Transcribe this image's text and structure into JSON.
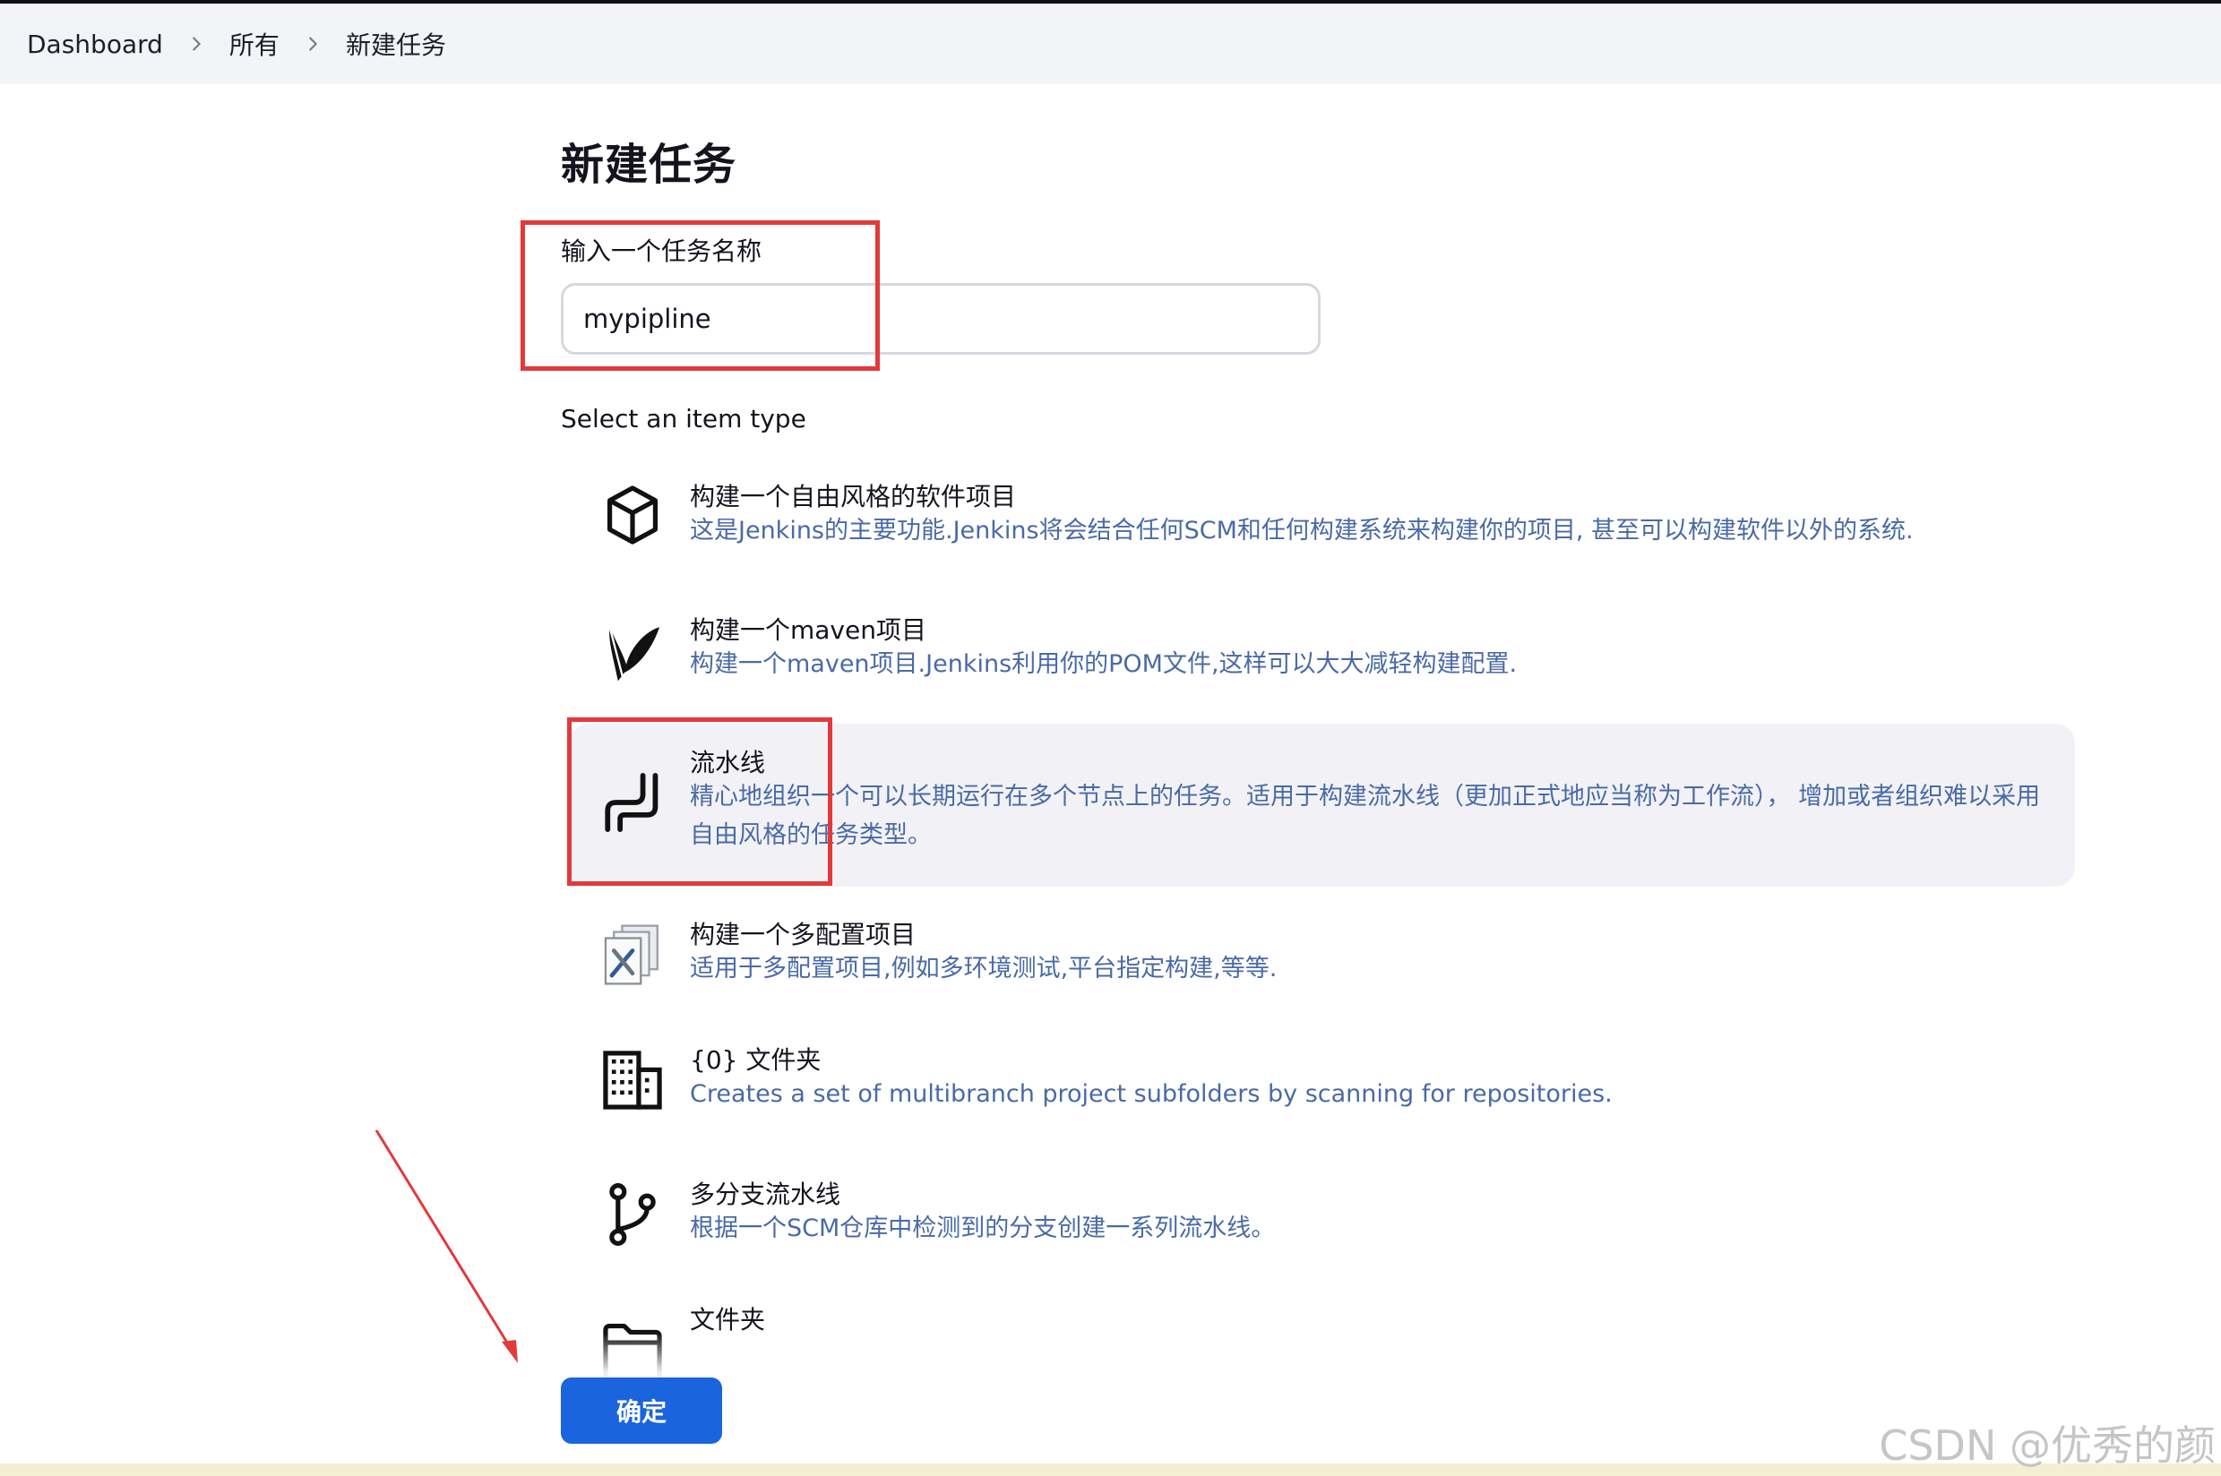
{
  "breadcrumb": [
    {
      "label": "Dashboard"
    },
    {
      "label": "所有"
    },
    {
      "label": "新建任务"
    }
  ],
  "page_title": "新建任务",
  "name_field": {
    "label": "输入一个任务名称",
    "value": "mypipline"
  },
  "item_type_label": "Select an item type",
  "items": [
    {
      "title": "构建一个自由风格的软件项目",
      "desc": "这是Jenkins的主要功能.Jenkins将会结合任何SCM和任何构建系统来构建你的项目, 甚至可以构建软件以外的系统.",
      "icon": "box-icon"
    },
    {
      "title": "构建一个maven项目",
      "desc": "构建一个maven项目.Jenkins利用你的POM文件,这样可以大大减轻构建配置.",
      "icon": "feather-icon"
    },
    {
      "title": "流水线",
      "desc": "精心地组织一个可以长期运行在多个节点上的任务。适用于构建流水线（更加正式地应当称为工作流）， 增加或者组织难以采用自由风格的任务类型。",
      "icon": "pipeline-icon",
      "selected": true
    },
    {
      "title": "构建一个多配置项目",
      "desc": "适用于多配置项目,例如多环境测试,平台指定构建,等等.",
      "icon": "multi-config-icon"
    },
    {
      "title": "{0} 文件夹",
      "desc": "Creates a set of multibranch project subfolders by scanning for repositories.",
      "icon": "building-icon"
    },
    {
      "title": "多分支流水线",
      "desc": "根据一个SCM仓库中检测到的分支创建一系列流水线。",
      "icon": "branch-icon"
    },
    {
      "title": "文件夹",
      "desc": "",
      "icon": "folder-icon"
    }
  ],
  "confirm_label": "确定",
  "watermark": "CSDN @优秀的颜",
  "colors": {
    "accent": "#1a64de",
    "description": "#4a6aa6",
    "annotation": "#e23a3a",
    "selected_bg": "#f2f2f6"
  }
}
